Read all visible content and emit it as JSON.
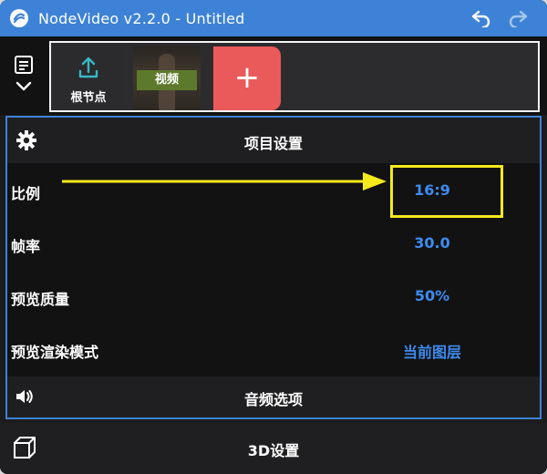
{
  "window": {
    "title": "NodeVideo v2.2.0 - Untitled",
    "accent_color": "#3d82d6"
  },
  "toolbar": {
    "undo_icon": "undo-icon",
    "redo_icon": "redo-icon"
  },
  "node_strip": {
    "nodes": [
      {
        "label": "根节点",
        "icon": "upload-icon"
      },
      {
        "label": "视频",
        "icon": "video-thumbnail"
      },
      {
        "label": "+",
        "icon": "add-icon",
        "color": "#ea5a5a"
      }
    ]
  },
  "project_settings": {
    "title": "项目设置",
    "rows": [
      {
        "label": "比例",
        "value": "16:9"
      },
      {
        "label": "帧率",
        "value": "30.0"
      },
      {
        "label": "预览质量",
        "value": "50%"
      },
      {
        "label": "预览渲染模式",
        "value": "当前图层"
      }
    ],
    "value_color": "#3d8bf0",
    "highlight_color": "#f5ea1c"
  },
  "audio_options": {
    "title": "音频选项"
  },
  "settings_3d": {
    "title": "3D设置"
  }
}
